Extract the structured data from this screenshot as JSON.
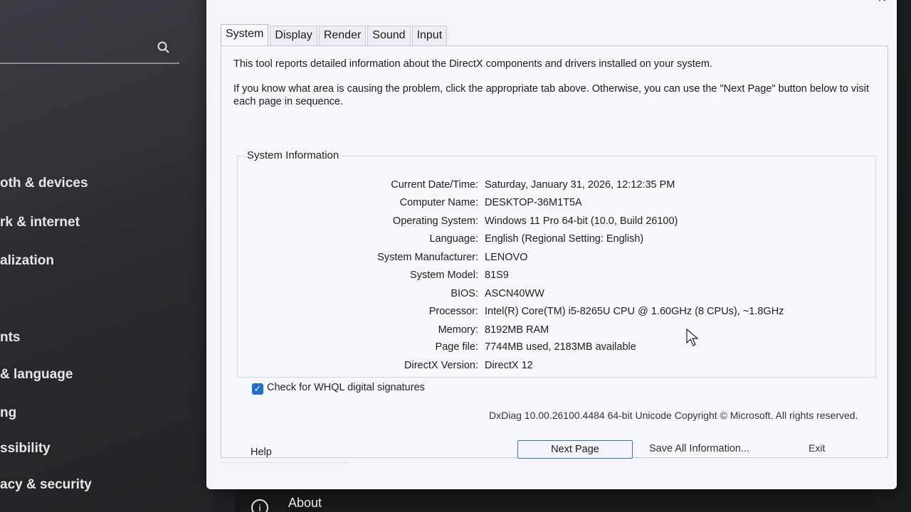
{
  "background_settings": {
    "nav_items": [
      {
        "label": "oth & devices"
      },
      {
        "label": "rk & internet"
      },
      {
        "label": "alization"
      },
      {
        "label": "nts"
      },
      {
        "label": "& language"
      },
      {
        "label": "ng"
      },
      {
        "label": "ssibility"
      },
      {
        "label": "acy & security"
      }
    ],
    "about_label": "About",
    "search_icon": "search-icon"
  },
  "dxdiag": {
    "tabs": [
      {
        "label": "System",
        "active": true
      },
      {
        "label": "Display",
        "active": false
      },
      {
        "label": "Render",
        "active": false
      },
      {
        "label": "Sound",
        "active": false
      },
      {
        "label": "Input",
        "active": false
      }
    ],
    "intro_1": "This tool reports detailed information about the DirectX components and drivers installed on your system.",
    "intro_2": "If you know what area is causing the problem, click the appropriate tab above.  Otherwise, you can use the \"Next Page\" button below to visit each page in sequence.",
    "system_information": {
      "legend": "System Information",
      "rows": [
        {
          "label": "Current Date/Time:",
          "value": "Saturday, January 31, 2026, 12:12:35 PM"
        },
        {
          "label": "Computer Name:",
          "value": "DESKTOP-36M1T5A"
        },
        {
          "label": "Operating System:",
          "value": "Windows 11 Pro 64-bit (10.0, Build 26100)"
        },
        {
          "label": "Language:",
          "value": "English (Regional Setting: English)"
        },
        {
          "label": "System Manufacturer:",
          "value": "LENOVO"
        },
        {
          "label": "System Model:",
          "value": "81S9"
        },
        {
          "label": "BIOS:",
          "value": "ASCN40WW"
        },
        {
          "label": "Processor:",
          "value": "Intel(R) Core(TM) i5-8265U CPU @ 1.60GHz (8 CPUs), ~1.8GHz"
        },
        {
          "label": "Memory:",
          "value": "8192MB RAM"
        },
        {
          "label": "Page file:",
          "value": "7744MB used, 2183MB available"
        },
        {
          "label": "DirectX Version:",
          "value": "DirectX 12"
        }
      ]
    },
    "whql": {
      "label": "Check for WHQL digital signatures",
      "checked": true
    },
    "copyright": "DxDiag 10.00.26100.4484 64-bit Unicode  Copyright © Microsoft. All rights reserved.",
    "buttons": {
      "help": "Help",
      "next_page": "Next Page",
      "save_all": "Save All Information...",
      "exit": "Exit"
    },
    "colors": {
      "accent": "#1f6fd0",
      "panel": "#f7f8fd"
    }
  }
}
